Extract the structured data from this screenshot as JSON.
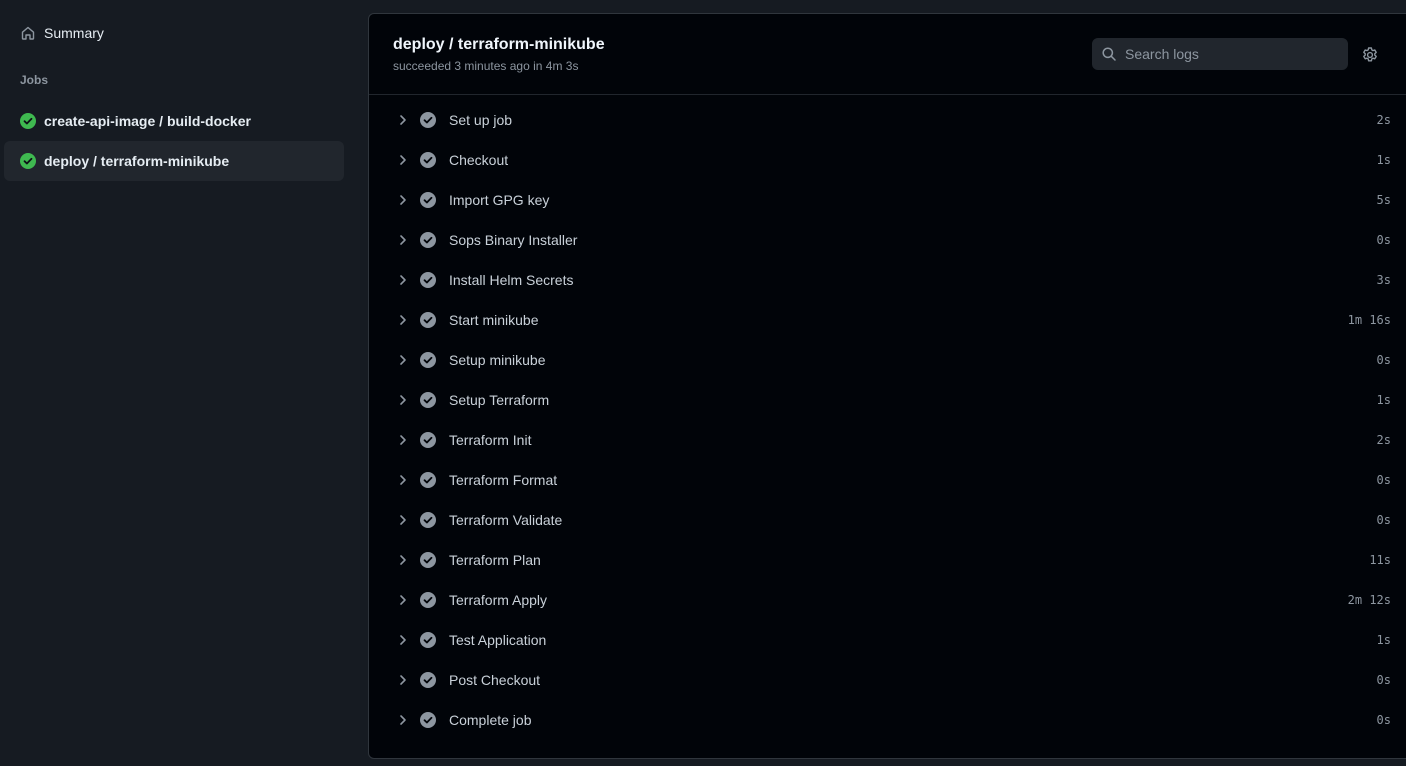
{
  "sidebar": {
    "summary_label": "Summary",
    "jobs_heading": "Jobs",
    "jobs": [
      {
        "label": "create-api-image / build-docker",
        "status": "success",
        "selected": false
      },
      {
        "label": "deploy / terraform-minikube",
        "status": "success",
        "selected": true
      }
    ]
  },
  "job": {
    "title": "deploy / terraform-minikube",
    "subtitle": "succeeded 3 minutes ago in 4m 3s"
  },
  "search": {
    "placeholder": "Search logs"
  },
  "steps": [
    {
      "name": "Set up job",
      "duration": "2s"
    },
    {
      "name": "Checkout",
      "duration": "1s"
    },
    {
      "name": "Import GPG key",
      "duration": "5s"
    },
    {
      "name": "Sops Binary Installer",
      "duration": "0s"
    },
    {
      "name": "Install Helm Secrets",
      "duration": "3s"
    },
    {
      "name": "Start minikube",
      "duration": "1m 16s"
    },
    {
      "name": "Setup minikube",
      "duration": "0s"
    },
    {
      "name": "Setup Terraform",
      "duration": "1s"
    },
    {
      "name": "Terraform Init",
      "duration": "2s"
    },
    {
      "name": "Terraform Format",
      "duration": "0s"
    },
    {
      "name": "Terraform Validate",
      "duration": "0s"
    },
    {
      "name": "Terraform Plan",
      "duration": "11s"
    },
    {
      "name": "Terraform Apply",
      "duration": "2m 12s"
    },
    {
      "name": "Test Application",
      "duration": "1s"
    },
    {
      "name": "Post Checkout",
      "duration": "0s"
    },
    {
      "name": "Complete job",
      "duration": "0s"
    }
  ],
  "colors": {
    "success_green": "#3fb950",
    "step_check_gray": "#8d96a0",
    "background": "#161b22",
    "panel": "#010409"
  },
  "icons": {
    "summary": "home-icon",
    "job_status": "check-circle-fill-icon",
    "search": "search-icon",
    "settings": "gear-icon",
    "step_expand": "chevron-right-icon",
    "step_status": "check-circle-fill-icon"
  }
}
